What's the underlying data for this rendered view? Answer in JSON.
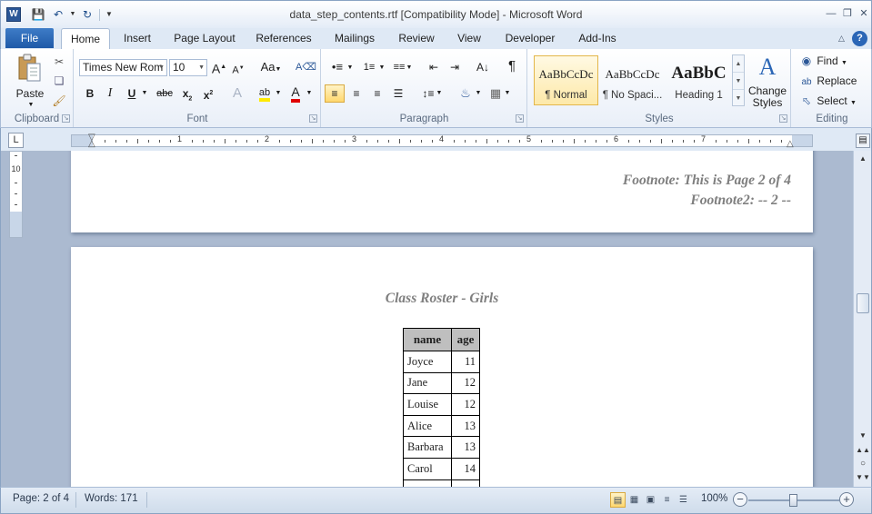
{
  "window": {
    "title": "data_step_contents.rtf [Compatibility Mode]  -  Microsoft Word",
    "app_icon_letter": "W"
  },
  "tabs": [
    {
      "label": "File"
    },
    {
      "label": "Home"
    },
    {
      "label": "Insert"
    },
    {
      "label": "Page Layout"
    },
    {
      "label": "References"
    },
    {
      "label": "Mailings"
    },
    {
      "label": "Review"
    },
    {
      "label": "View"
    },
    {
      "label": "Developer"
    },
    {
      "label": "Add-Ins"
    }
  ],
  "active_tab": "Home",
  "ribbon": {
    "clipboard": {
      "label": "Clipboard",
      "paste_label": "Paste"
    },
    "font": {
      "label": "Font",
      "font_name": "Times New Rom",
      "font_size": "10"
    },
    "paragraph": {
      "label": "Paragraph"
    },
    "styles": {
      "label": "Styles",
      "items": [
        {
          "sample": "AaBbCcDc",
          "name": "¶ Normal",
          "selected": true
        },
        {
          "sample": "AaBbCcDc",
          "name": "¶ No Spaci...",
          "selected": false
        },
        {
          "sample": "AaBbC",
          "name": "Heading 1",
          "selected": false
        }
      ],
      "change_styles_label": "Change Styles"
    },
    "editing": {
      "label": "Editing",
      "find": "Find",
      "replace": "Replace",
      "select": "Select"
    }
  },
  "ruler": {
    "numbers": [
      "1",
      "2",
      "3",
      "4",
      "5",
      "6",
      "7"
    ],
    "vertical_number": "10"
  },
  "document": {
    "footnote1": "Footnote: This is Page 2 of 4",
    "footnote2": "Footnote2: -- 2 --",
    "roster_title": "Class Roster - Girls",
    "table": {
      "headers": [
        "name",
        "age"
      ],
      "rows": [
        [
          "Joyce",
          "11"
        ],
        [
          "Jane",
          "12"
        ],
        [
          "Louise",
          "12"
        ],
        [
          "Alice",
          "13"
        ],
        [
          "Barbara",
          "13"
        ],
        [
          "Carol",
          "14"
        ]
      ]
    }
  },
  "statusbar": {
    "page": "Page: 2 of 4",
    "words": "Words: 171",
    "zoom": "100%",
    "zoom_percent": 100
  },
  "colors": {
    "file_tab": "#2a62b0",
    "ribbon_bg": "#e9eff8",
    "doc_bg": "#abbad0",
    "footnote_text": "#7f7f7f",
    "table_header_bg": "#bfbfbf",
    "selected_style": "#fde9a9"
  }
}
